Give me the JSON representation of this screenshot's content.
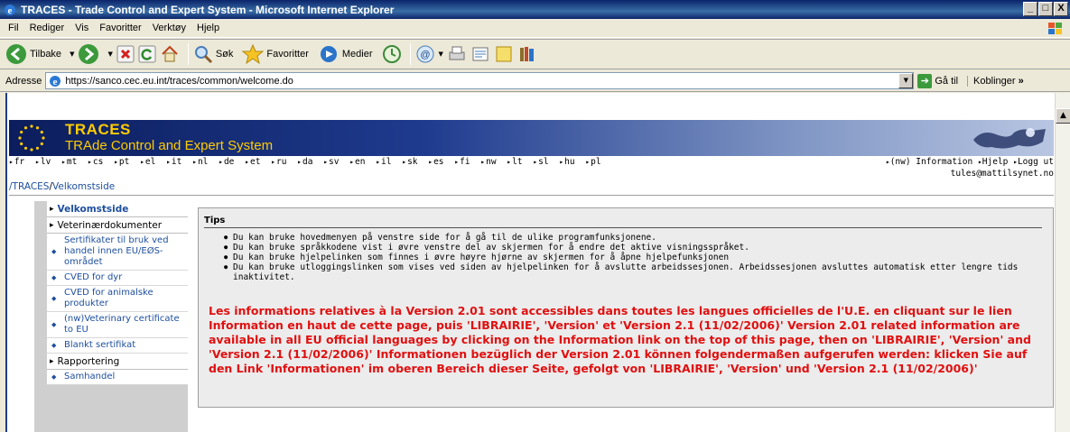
{
  "window": {
    "title": "TRACES - Trade Control and Expert System - Microsoft Internet Explorer",
    "buttons": [
      "_",
      "□",
      "X"
    ]
  },
  "menubar": {
    "items": [
      "Fil",
      "Rediger",
      "Vis",
      "Favoritter",
      "Verktøy",
      "Hjelp"
    ]
  },
  "toolbar": {
    "back_label": "Tilbake",
    "search_label": "Søk",
    "favorites_label": "Favoritter",
    "media_label": "Medier"
  },
  "addressbar": {
    "label": "Adresse",
    "url": "https://sanco.cec.eu.int/traces/common/welcome.do",
    "go_label": "Gå til",
    "links_label": "Koblinger",
    "links_more": "»"
  },
  "header": {
    "logo_title": "TRACES",
    "logo_subtitle": "TRAde Control and Expert System",
    "languages": [
      "fr",
      "lv",
      "mt",
      "cs",
      "pt",
      "el",
      "it",
      "nl",
      "de",
      "et",
      "ru",
      "da",
      "sv",
      "en",
      "il",
      "sk",
      "es",
      "fi",
      "nw",
      "lt",
      "sl",
      "hu",
      "pl"
    ],
    "info_link": "(nw) Information",
    "help_link": "Hjelp",
    "logout_link": "Logg ut",
    "user_email": "tules@mattilsynet.no"
  },
  "breadcrumb": {
    "root": "/TRACES",
    "separator": "/",
    "current": "Velkomstside"
  },
  "sidebar": {
    "welcome": "Velkomstside",
    "vet_docs": "Veterinærdokumenter",
    "items": [
      "Sertifikater til bruk ved handel innen EU/EØS-området",
      "CVED for dyr",
      "CVED for animalske produkter",
      "(nw)Veterinary certificate to EU",
      "Blankt sertifikat"
    ],
    "reporting": "Rapportering",
    "report_items": [
      "Samhandel"
    ]
  },
  "tips": {
    "title": "Tips",
    "items": [
      "Du kan bruke hovedmenyen på venstre side for å gå til de ulike programfunksjonene.",
      "Du kan bruke språkkodene vist i øvre venstre del av skjermen for å endre det aktive visningsspråket.",
      "Du kan bruke hjelpelinken som finnes i øvre høyre hjørne av skjermen for å åpne hjelpefunksjonen",
      "Du kan bruke utloggingslinken som vises ved siden av hjelpelinken for å avslutte arbeidssesjonen. Arbeidssesjonen avsluttes automatisk etter lengre tids inaktivitet."
    ],
    "notice": "Les informations relatives à la Version 2.01 sont accessibles dans toutes les langues officielles de l'U.E. en cliquant sur le lien Information en haut de cette page, puis 'LIBRAIRIE', 'Version' et 'Version 2.1 (11/02/2006)' Version 2.01 related information are available in all EU official languages by clicking on the Information link on the top of this page, then on 'LIBRAIRIE', 'Version' and 'Version 2.1 (11/02/2006)' Informationen bezüglich der Version 2.01 können folgendermaßen aufgerufen werden: klicken Sie auf den Link 'Informationen' im oberen Bereich dieser Seite, gefolgt von 'LIBRAIRIE', 'Version' und 'Version 2.1 (11/02/2006)'"
  },
  "colors": {
    "notice_red": "#e01010",
    "link_blue": "#1d4e9e",
    "header_gold": "#ffcc00"
  }
}
